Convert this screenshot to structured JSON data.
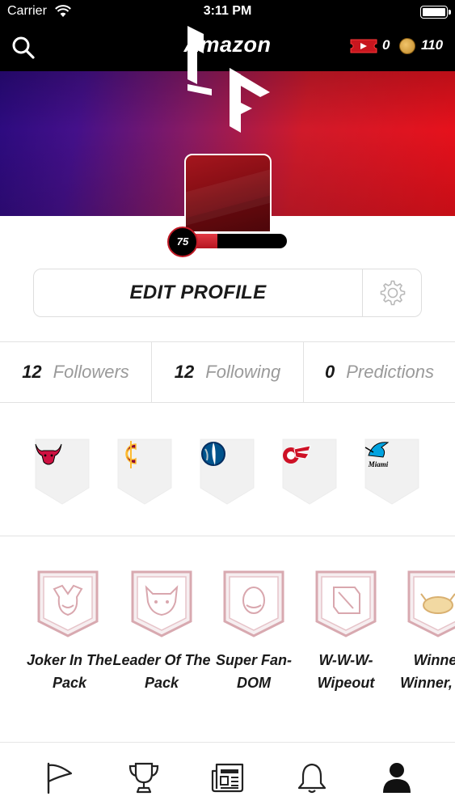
{
  "status_bar": {
    "carrier": "Carrier",
    "time": "3:11 PM"
  },
  "nav": {
    "title": "Amazon",
    "ticket_count": "0",
    "coin_count": "110"
  },
  "profile": {
    "level": "75",
    "level_progress": 0.3,
    "edit_label": "EDIT PROFILE"
  },
  "stats": [
    {
      "value": "12",
      "label": "Followers"
    },
    {
      "value": "12",
      "label": "Following"
    },
    {
      "value": "0",
      "label": "Predictions"
    }
  ],
  "teams": [
    {
      "icon": "bulls-logo-icon"
    },
    {
      "icon": "cavaliers-logo-icon"
    },
    {
      "icon": "mavericks-logo-icon"
    },
    {
      "icon": "red-wings-logo-icon"
    },
    {
      "icon": "marlins-logo-icon",
      "logo_text": "Miami"
    }
  ],
  "badges": [
    {
      "line1": "Joker In The",
      "line2": "Pack"
    },
    {
      "line1": "Leader Of The",
      "line2": "Pack"
    },
    {
      "line1": "Super Fan-",
      "line2": "DOM"
    },
    {
      "line1": "W-W-W-",
      "line2": "Wipeout"
    },
    {
      "line1": "Winner",
      "line2": "Winner, Ch"
    }
  ],
  "tabs": [
    "flag-icon",
    "trophy-icon",
    "newspaper-icon",
    "bell-icon",
    "user-icon"
  ],
  "colors": {
    "accent": "#c01a26",
    "nav": "#000000",
    "muted_text": "#9a9a9a"
  }
}
